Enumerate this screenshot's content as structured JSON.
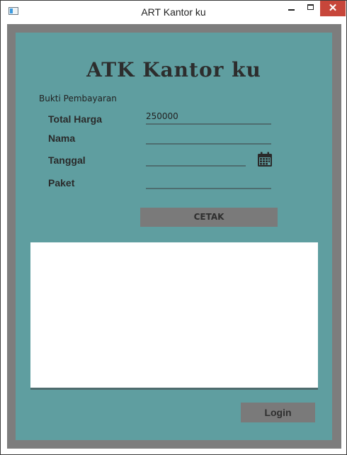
{
  "window": {
    "title": "ART Kantor ku",
    "minimize_icon": "minimize-icon",
    "maximize_icon": "maximize-icon",
    "close_label": "✕"
  },
  "form": {
    "heading": "ATK Kantor ku",
    "subtitle": "Bukti Pembayaran",
    "total_harga_label": "Total Harga",
    "total_harga_value": "250000",
    "nama_label": "Nama",
    "nama_value": "",
    "tanggal_label": "Tanggal",
    "tanggal_value": "",
    "paket_label": "Paket",
    "paket_value": "",
    "calendar_icon": "calendar-icon",
    "cetak_label": "CETAK",
    "print_area_text": "",
    "login_label": "Login"
  },
  "colors": {
    "panel": "#5f9ea0",
    "frame": "#7d7d7d",
    "button": "#7a7a7a",
    "close": "#c7463a"
  }
}
